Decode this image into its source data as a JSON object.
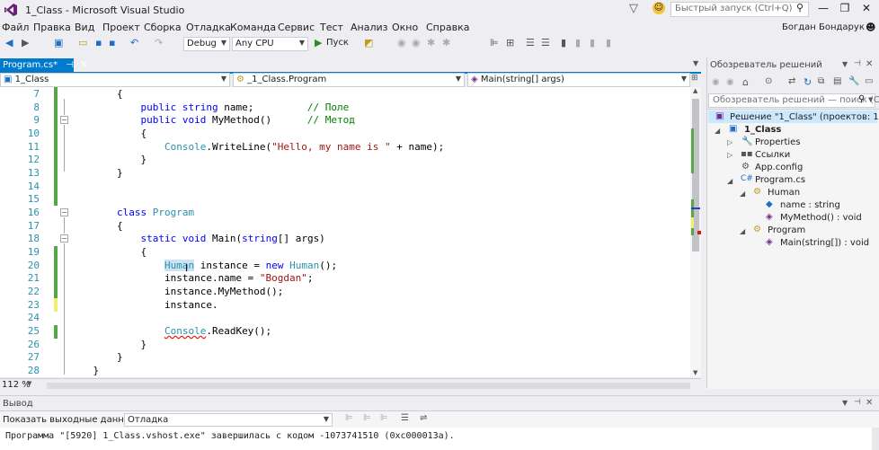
{
  "window": {
    "title": "1_Class - Microsoft Visual Studio",
    "quick_launch_placeholder": "Быстрый запуск (Ctrl+Q)",
    "user": "Богдан Бондарук"
  },
  "menu": [
    "Файл",
    "Правка",
    "Вид",
    "Проект",
    "Сборка",
    "Отладка",
    "Команда",
    "Сервис",
    "Тест",
    "Анализ",
    "Окно",
    "Справка"
  ],
  "toolbar": {
    "config": "Debug",
    "platform": "Any CPU",
    "start_label": "Пуск"
  },
  "tab": {
    "label": "Program.cs*"
  },
  "navbar": {
    "project": "1_Class",
    "class": "_1_Class.Program",
    "member": "Main(string[] args)"
  },
  "editor": {
    "lines": [
      {
        "n": "7",
        "t": "        {"
      },
      {
        "n": "8",
        "t": "            public string name;         // Поле"
      },
      {
        "n": "9",
        "t": "            public void MyMethod()      // Метод"
      },
      {
        "n": "10",
        "t": "            {"
      },
      {
        "n": "11",
        "t": "                Console.WriteLine(\"Hello, my name is \" + name);"
      },
      {
        "n": "12",
        "t": "            }"
      },
      {
        "n": "13",
        "t": "        }"
      },
      {
        "n": "14",
        "t": ""
      },
      {
        "n": "15",
        "t": ""
      },
      {
        "n": "16",
        "t": "        class Program"
      },
      {
        "n": "17",
        "t": "        {"
      },
      {
        "n": "18",
        "t": "            static void Main(string[] args)"
      },
      {
        "n": "19",
        "t": "            {"
      },
      {
        "n": "20",
        "t": "                Human instance = new Human();"
      },
      {
        "n": "21",
        "t": "                instance.name = \"Bogdan\";"
      },
      {
        "n": "22",
        "t": "                instance.MyMethod();"
      },
      {
        "n": "23",
        "t": "                instance."
      },
      {
        "n": "24",
        "t": ""
      },
      {
        "n": "25",
        "t": "                Console.ReadKey();"
      },
      {
        "n": "26",
        "t": "            }"
      },
      {
        "n": "27",
        "t": "        }"
      },
      {
        "n": "28",
        "t": "    }"
      }
    ],
    "zoom": "112 %"
  },
  "solution_explorer": {
    "title": "Обозреватель решений",
    "search_placeholder": "Обозреватель решений — поиск (Ctrl",
    "items": [
      {
        "label": "Решение \"1_Class\" (проектов: 1)"
      },
      {
        "label": "1_Class"
      },
      {
        "label": "Properties"
      },
      {
        "label": "Ссылки"
      },
      {
        "label": "App.config"
      },
      {
        "label": "Program.cs"
      },
      {
        "label": "Human"
      },
      {
        "label": "name : string"
      },
      {
        "label": "MyMethod() : void"
      },
      {
        "label": "Program"
      },
      {
        "label": "Main(string[]) : void"
      }
    ]
  },
  "output": {
    "title": "Вывод",
    "show_label": "Показать выходные данные из:",
    "source": "Отладка",
    "text": "Программа \"[5920] 1_Class.vshost.exe\" завершилась с кодом -1073741510 (0xc000013a)."
  }
}
